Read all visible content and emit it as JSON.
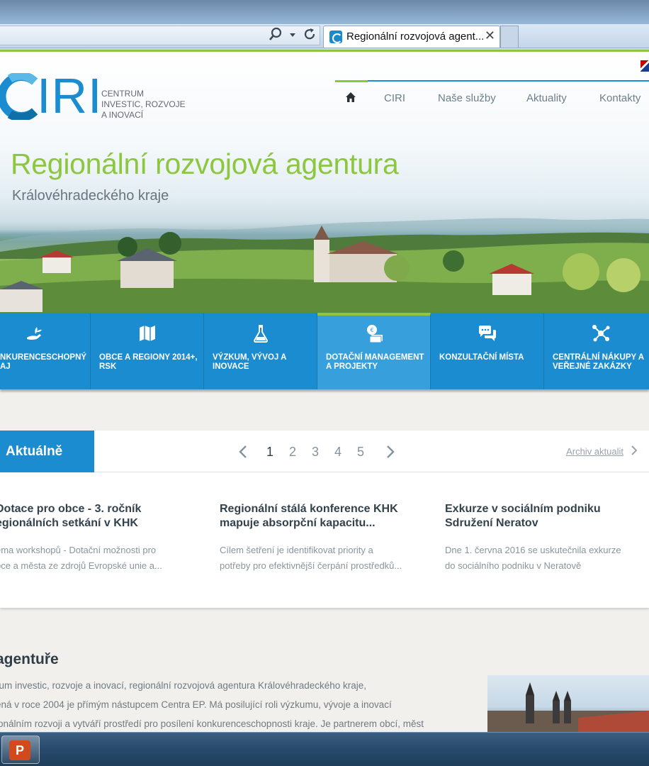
{
  "browser": {
    "tab_title": "Regionální rozvojová agent...",
    "tab_close": "✕"
  },
  "logo": {
    "wordmark": "IRI",
    "subtitle_line1": "CENTRUM",
    "subtitle_line2": "INVESTIC, ROZVOJE",
    "subtitle_line3": "A INOVACÍ"
  },
  "nav": {
    "items": [
      {
        "label": "CIRI"
      },
      {
        "label": "Naše služby"
      },
      {
        "label": "Aktuality"
      },
      {
        "label": "Kontakty"
      }
    ]
  },
  "hero": {
    "title": "Regionální rozvojová agentura",
    "subtitle": "Královéhradeckého kraje"
  },
  "categories": [
    {
      "line1": "NKURENCESCHOPNÝ",
      "line2": "AJ",
      "icon": "hand-plant-icon"
    },
    {
      "line1": "OBCE A REGIONY 2014+,",
      "line2": "RSK",
      "icon": "map-icon"
    },
    {
      "line1": "VÝZKUM, VÝVOJ A",
      "line2": "INOVACE",
      "icon": "flask-icon"
    },
    {
      "line1": "DOTAČNÍ MANAGEMENT",
      "line2": "A PROJEKTY",
      "icon": "money-icon"
    },
    {
      "line1": "KONZULTAČNÍ MÍSTA",
      "line2": "",
      "icon": "chat-icon"
    },
    {
      "line1": "CENTRÁLNÍ NÁKUPY A",
      "line2": "VEŘEJNÉ ZAKÁZKY",
      "icon": "network-icon"
    }
  ],
  "news": {
    "label": "Aktuálně",
    "pages": [
      "1",
      "2",
      "3",
      "4",
      "5"
    ],
    "current_page": "1",
    "archive_link": "Archiv aktualit",
    "articles": [
      {
        "title_line1": "Dotace pro obce - 3. ročník",
        "title_line2": "egionálních setkání v KHK",
        "text_line1": "éma workshopů - Dotační možnosti pro",
        "text_line2": "bce a města ze zdrojů Evropské unie a..."
      },
      {
        "title_line1": "Regionální stálá konference KHK",
        "title_line2": "mapuje absorpční kapacitu...",
        "text_line1": "Cílem šetření je identifikovat priority a",
        "text_line2": "potřeby pro efektivnější čerpání prostředků..."
      },
      {
        "title_line1": "Exkurze v sociálním podniku",
        "title_line2": "Sdružení Neratov",
        "text_line1": "Dne 1. června 2016 se uskutečnila exkurze",
        "text_line2": "do sociálního podniku v Neratově"
      }
    ]
  },
  "about": {
    "heading": "agentuře",
    "line1": "rum investic, rozvoje a inovací, regionální rozvojová agentura Královéhradeckého kraje,",
    "line2": "ená v roce 2004 je přímým nástupcem Centra EP. Má posilující roli výzkumu, vývoje a inovací",
    "line3": "ionálním rozvoji a vytváří prostředí pro posílení konkurenceschopnosti kraje. Je partnerem obcí, měst"
  },
  "colors": {
    "brand_blue": "#1a8ccf",
    "brand_green": "#8dc63f"
  }
}
